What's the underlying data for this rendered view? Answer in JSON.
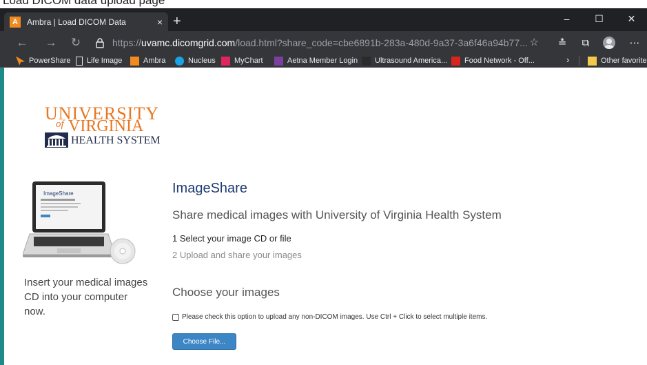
{
  "caption": "Load DICOM data upload page",
  "browser": {
    "tab": {
      "title": "Ambra | Load DICOM Data",
      "favicon_letter": "A",
      "close_glyph": "×"
    },
    "new_tab_glyph": "+",
    "window_controls": [
      "–",
      "☐",
      "✕"
    ],
    "url": {
      "scheme": "https://",
      "host": "uvamc.dicomgrid.com",
      "path": "/load.html?share_code=cbe6891b-283a-480d-9a37-3a6f46a94b77..."
    },
    "bookmarks": [
      "PowerShare",
      "Life Image",
      "Ambra",
      "Nucleus",
      "MyChart",
      "Aetna Member Login",
      "Ultrasound America...",
      "Food Network - Off...",
      "Other favorites"
    ],
    "bookmark_icons": [
      "cursor-icon",
      "page-icon",
      "ambra-icon",
      "nucleus-icon",
      "mychart-icon",
      "aetna-icon",
      "blank-icon",
      "foodnetwork-icon",
      "folder-icon"
    ],
    "bookmark_colors": [
      "#f28b1f",
      "#e8eaed",
      "#f28b1f",
      "#1aa3e8",
      "#e0245e",
      "#7b3fa0",
      "#2b2b2b",
      "#d9251d",
      "#f2c94c"
    ]
  },
  "logo": {
    "line1": "UNIVERSITY",
    "of": "of",
    "line2": "VIRGINIA",
    "line3": "HEALTH SYSTEM"
  },
  "laptop_screen": {
    "title": "ImageShare"
  },
  "sidebar": {
    "insert_text": "Insert your medical images CD into your computer now."
  },
  "main": {
    "title": "ImageShare",
    "subtitle": "Share medical images with University of Virginia Health System",
    "step1": "1 Select your image CD or file",
    "step2": "2 Upload and share your images",
    "choose_heading": "Choose your images",
    "checkbox_label": "Please check this option to upload any non-DICOM images. Use Ctrl + Click to select multiple items.",
    "checkbox_checked": false,
    "choose_button": "Choose File..."
  },
  "colors": {
    "accent": "#3c86c6",
    "heading": "#1f3b73",
    "uva_orange": "#e87722",
    "uva_navy": "#232d4b",
    "page_border": "#1e8a8a"
  }
}
